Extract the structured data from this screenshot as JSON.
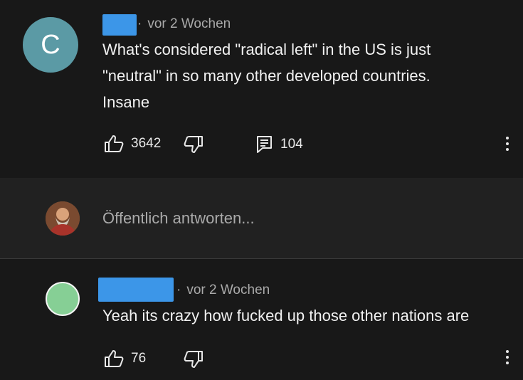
{
  "comments": [
    {
      "avatar_letter": "C",
      "timestamp": "vor 2 Wochen",
      "text_lines": [
        "What's considered \"radical left\" in the US is just",
        "\"neutral\" in so many other developed countries.",
        "Insane"
      ],
      "likes": "3642",
      "replies": "104"
    },
    {
      "timestamp": "vor 2 Wochen",
      "text": "Yeah its crazy how fucked up those other nations are",
      "likes": "76"
    }
  ],
  "reply_box": {
    "placeholder": "Öffentlich antworten..."
  },
  "icons": {
    "like": "thumb-up-icon",
    "dislike": "thumb-down-icon",
    "reply": "comment-icon",
    "more": "more-vertical-icon"
  },
  "colors": {
    "background": "#181818",
    "accent_redaction": "#3c96e8",
    "avatar": "#5b9aa5"
  }
}
